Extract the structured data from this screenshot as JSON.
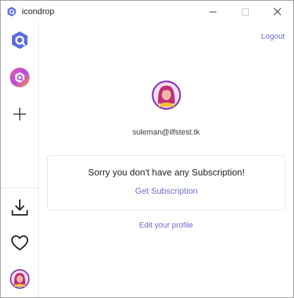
{
  "window": {
    "title": "icondrop",
    "controls": {
      "minimize": "minimize",
      "maximize": "maximize",
      "close": "close"
    }
  },
  "sidebar": {
    "items": [
      {
        "name": "logo",
        "icon": "icondrop-logo-icon"
      },
      {
        "name": "workspace",
        "icon": "icondrop-gradient-icon"
      },
      {
        "name": "add",
        "icon": "plus-icon"
      }
    ],
    "bottom_items": [
      {
        "name": "downloads",
        "icon": "download-icon"
      },
      {
        "name": "favorites",
        "icon": "heart-icon"
      },
      {
        "name": "profile",
        "icon": "avatar"
      }
    ]
  },
  "main": {
    "logout_label": "Logout",
    "email": "suleman@ilfstest.tk",
    "subscription": {
      "message": "Sorry you don't have any Subscription!",
      "cta_label": "Get Subscription"
    },
    "edit_profile_label": "Edit your profile"
  },
  "colors": {
    "accent": "#6b6bd8",
    "logo_blue": "#5a6ee0",
    "avatar_ring": "#8a3fb0",
    "avatar_hair": "#c0307a"
  }
}
